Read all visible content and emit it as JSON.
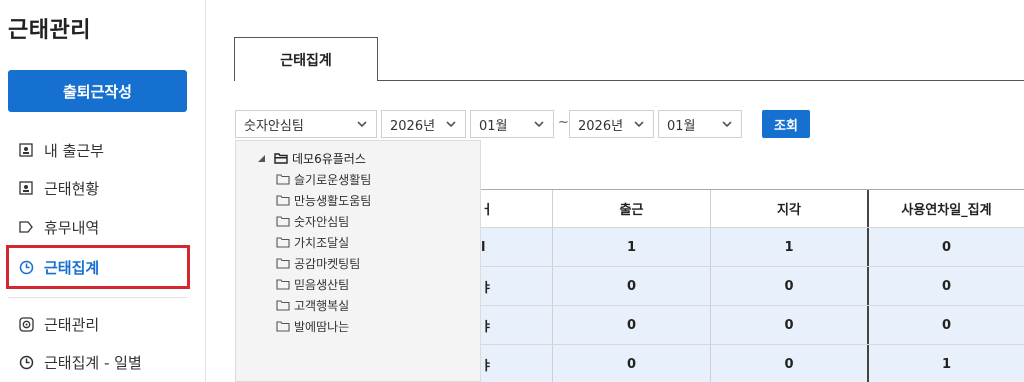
{
  "sidebar": {
    "title": "근태관리",
    "primary_button": "출퇴근작성",
    "items": [
      {
        "label": "내 출근부",
        "icon": "person-badge-icon"
      },
      {
        "label": "근태현황",
        "icon": "person-badge-icon"
      },
      {
        "label": "휴무내역",
        "icon": "tag-icon"
      },
      {
        "label": "근태집계",
        "icon": "clock-icon",
        "active": true
      },
      {
        "label": "근태관리",
        "icon": "target-icon"
      },
      {
        "label": "근태집계 - 일별",
        "icon": "clock-icon"
      }
    ]
  },
  "main": {
    "tab_label": "근태집계",
    "filters": {
      "team": "숫자안심팀",
      "start_year": "2026년",
      "start_month": "01월",
      "separator": "~",
      "end_year": "2026년",
      "end_month": "01월",
      "search_button": "조회"
    },
    "dropdown": {
      "root": "데모6유플러스",
      "items": [
        "슬기로운생활팀",
        "만능생활도움팀",
        "숫자안심팀",
        "가치조달실",
        "공감마켓팅팀",
        "믿음생산팀",
        "고객행복실",
        "발에땀나는"
      ]
    },
    "table": {
      "headers": [
        "ㅓ",
        "출근",
        "지각",
        "사용연차일_집계"
      ],
      "rows": [
        [
          "l",
          "1",
          "1",
          "0"
        ],
        [
          "ㅑ",
          "0",
          "0",
          "0"
        ],
        [
          "ㅑ",
          "0",
          "0",
          "0"
        ],
        [
          "ㅑ",
          "0",
          "0",
          "1"
        ]
      ]
    }
  },
  "colors": {
    "accent": "#1570cf",
    "highlight_border": "#d6262f",
    "row_bg": "#e8f0fb"
  }
}
